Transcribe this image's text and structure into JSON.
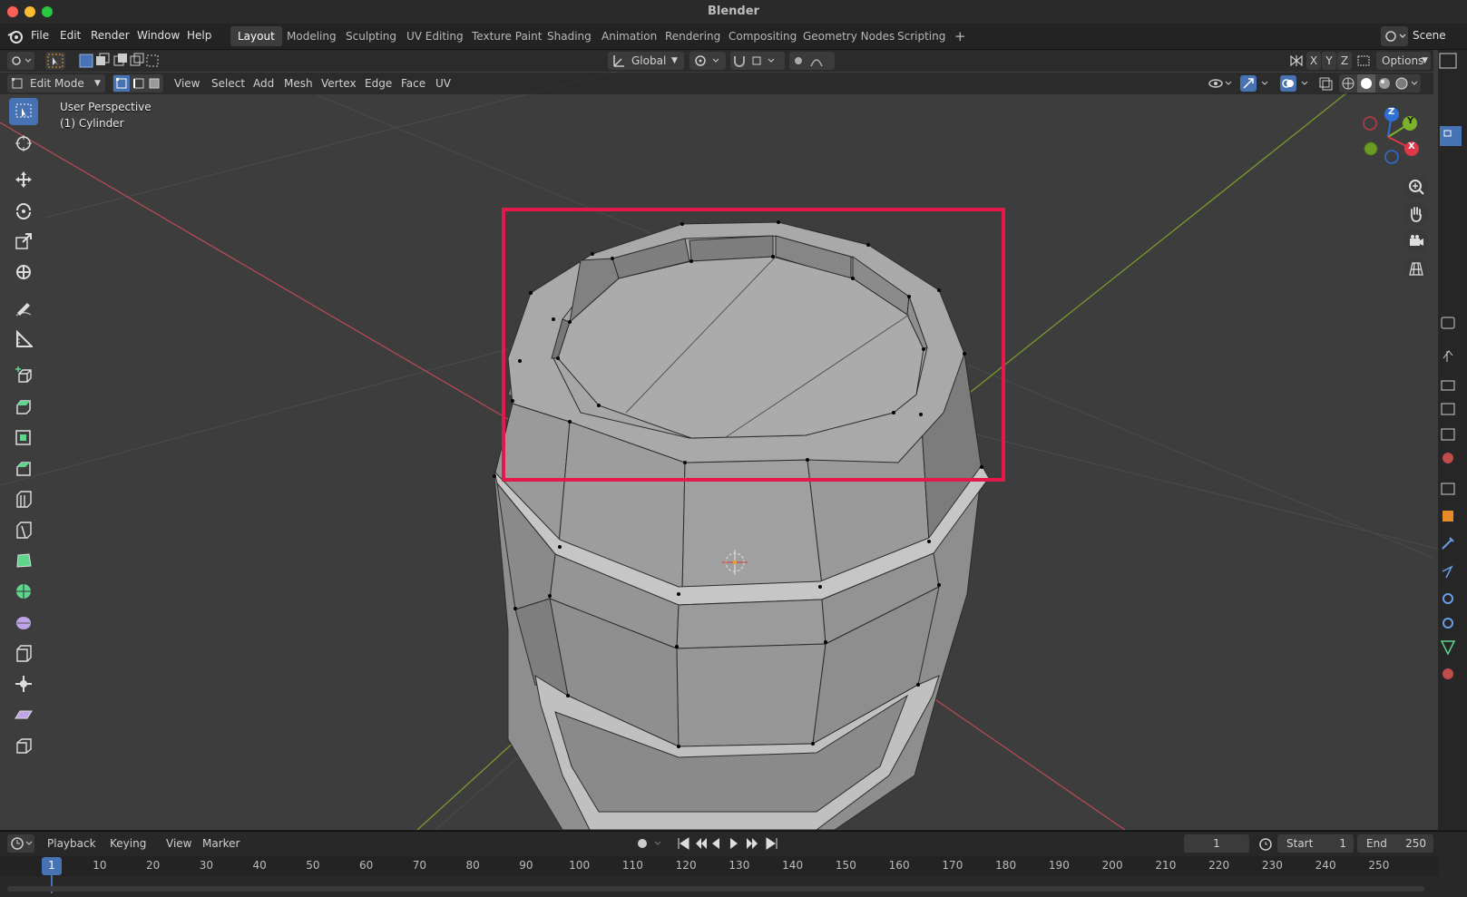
{
  "window": {
    "title": "Blender"
  },
  "menubar": {
    "items": [
      "File",
      "Edit",
      "Render",
      "Window",
      "Help"
    ]
  },
  "workspaces": {
    "tabs": [
      "Layout",
      "Modeling",
      "Sculpting",
      "UV Editing",
      "Texture Paint",
      "Shading",
      "Animation",
      "Rendering",
      "Compositing",
      "Geometry Nodes",
      "Scripting"
    ],
    "active": "Layout",
    "add": "+"
  },
  "scene": {
    "label": "Scene"
  },
  "tool_header": {
    "orientation": "Global",
    "options": "Options",
    "axes": [
      "X",
      "Y",
      "Z"
    ]
  },
  "editor_header": {
    "mode": "Edit Mode",
    "menus": [
      "View",
      "Select",
      "Add",
      "Mesh",
      "Vertex",
      "Edge",
      "Face",
      "UV"
    ]
  },
  "viewport": {
    "perspective": "User Perspective",
    "object": "(1) Cylinder",
    "gizmo": {
      "z": "Z",
      "y": "Y",
      "x": "X"
    },
    "highlight_color": "#e8174b"
  },
  "toolbar": {
    "tools": [
      "select-box-icon",
      "cursor-icon",
      "move-icon",
      "rotate-icon",
      "scale-icon",
      "transform-icon",
      "annotate-icon",
      "measure-icon",
      "add-cube-icon",
      "extrude-icon",
      "inset-icon",
      "bevel-icon",
      "loop-cut-icon",
      "knife-icon",
      "poly-build-icon",
      "spin-icon",
      "smooth-icon",
      "edge-slide-icon",
      "shrink-fatten-icon",
      "shear-icon",
      "rip-icon"
    ]
  },
  "timeline": {
    "menus": [
      "Playback",
      "Keying",
      "View",
      "Marker"
    ],
    "current_frame": "1",
    "start_label": "Start",
    "start": "1",
    "end_label": "End",
    "end": "250",
    "ticks": [
      "1",
      "10",
      "20",
      "30",
      "40",
      "50",
      "60",
      "70",
      "80",
      "90",
      "100",
      "110",
      "120",
      "130",
      "140",
      "150",
      "160",
      "170",
      "180",
      "190",
      "200",
      "210",
      "220",
      "230",
      "240",
      "250"
    ]
  }
}
